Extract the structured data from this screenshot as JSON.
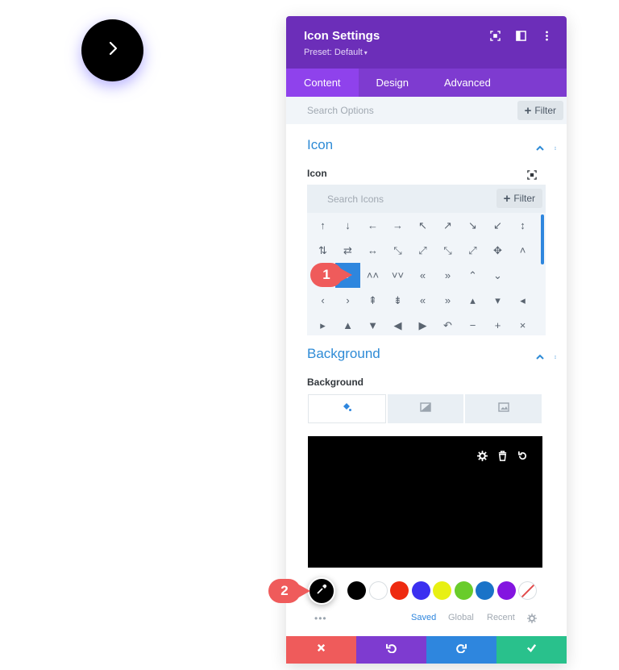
{
  "panel": {
    "title": "Icon Settings",
    "preset": "Preset: Default",
    "preset_caret": "▾"
  },
  "tabs": [
    "Content",
    "Design",
    "Advanced"
  ],
  "search": {
    "placeholder": "Search Options",
    "filter_label": "Filter"
  },
  "icon_section": {
    "title": "Icon",
    "field_label": "Icon",
    "search_placeholder": "Search Icons",
    "filter_label": "Filter",
    "selected_icon": "chevron-right",
    "grid": [
      [
        "↑",
        "↓",
        "←",
        "→",
        "↖",
        "↗",
        "↘",
        "↙",
        "↕"
      ],
      [
        "⇅",
        "⇄",
        "↔",
        "⤡",
        "⤢",
        "⤡",
        "⤢",
        "✥",
        "˄"
      ],
      [
        "",
        "›",
        "˄˄",
        "˅˅",
        "«",
        "»",
        "⌃",
        "⌄",
        ""
      ],
      [
        "‹",
        "›",
        "⇞",
        "⇟",
        "«",
        "»",
        "▴",
        "▾",
        "◂"
      ],
      [
        "▸",
        "▲",
        "▼",
        "◀",
        "▶",
        "↶",
        "−",
        "+",
        "×"
      ]
    ]
  },
  "background_section": {
    "title": "Background",
    "field_label": "Background",
    "color": "#000000",
    "swatches": [
      "#000000",
      "#ffffff",
      "#ee2a10",
      "#3b30f0",
      "#e8f013",
      "#69cc2b",
      "#1a73c8",
      "#8315e0",
      "none"
    ],
    "palette_tabs": [
      "Saved",
      "Global",
      "Recent"
    ],
    "dots": "•••"
  },
  "markers": [
    "1",
    "2"
  ],
  "colors": {
    "header": "#6c2eb9",
    "accent": "#2e86de"
  }
}
